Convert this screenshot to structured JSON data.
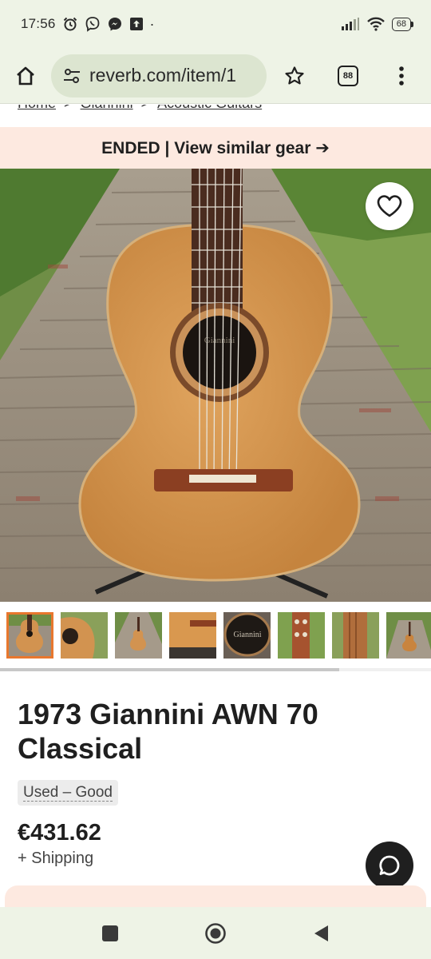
{
  "status_bar": {
    "time": "17:56",
    "battery": "68"
  },
  "browser": {
    "url": "reverb.com/item/1",
    "tab_count": "88"
  },
  "breadcrumb": {
    "items": [
      "Home",
      "Giannini",
      "Acoustic Guitars"
    ],
    "separator": ">"
  },
  "banner": {
    "text": "ENDED | View similar gear ➔"
  },
  "listing": {
    "title": "1973 Giannini AWN 70 Classical",
    "condition": "Used – Good",
    "price": "€431.62",
    "shipping": "+ Shipping",
    "soundhole_brand": "Giannini"
  },
  "thumbnails": {
    "count": 8,
    "active_index": 0
  },
  "colors": {
    "accent": "#e8772e",
    "banner_bg": "#fde9e0",
    "system_bar_bg": "#eef3e6"
  },
  "icons": {
    "home": "home-icon",
    "site_settings": "tune-icon",
    "bookmark": "star-outline-icon",
    "menu": "more-vert-icon",
    "favorite": "heart-outline-icon",
    "chat": "chat-bubble-icon"
  }
}
